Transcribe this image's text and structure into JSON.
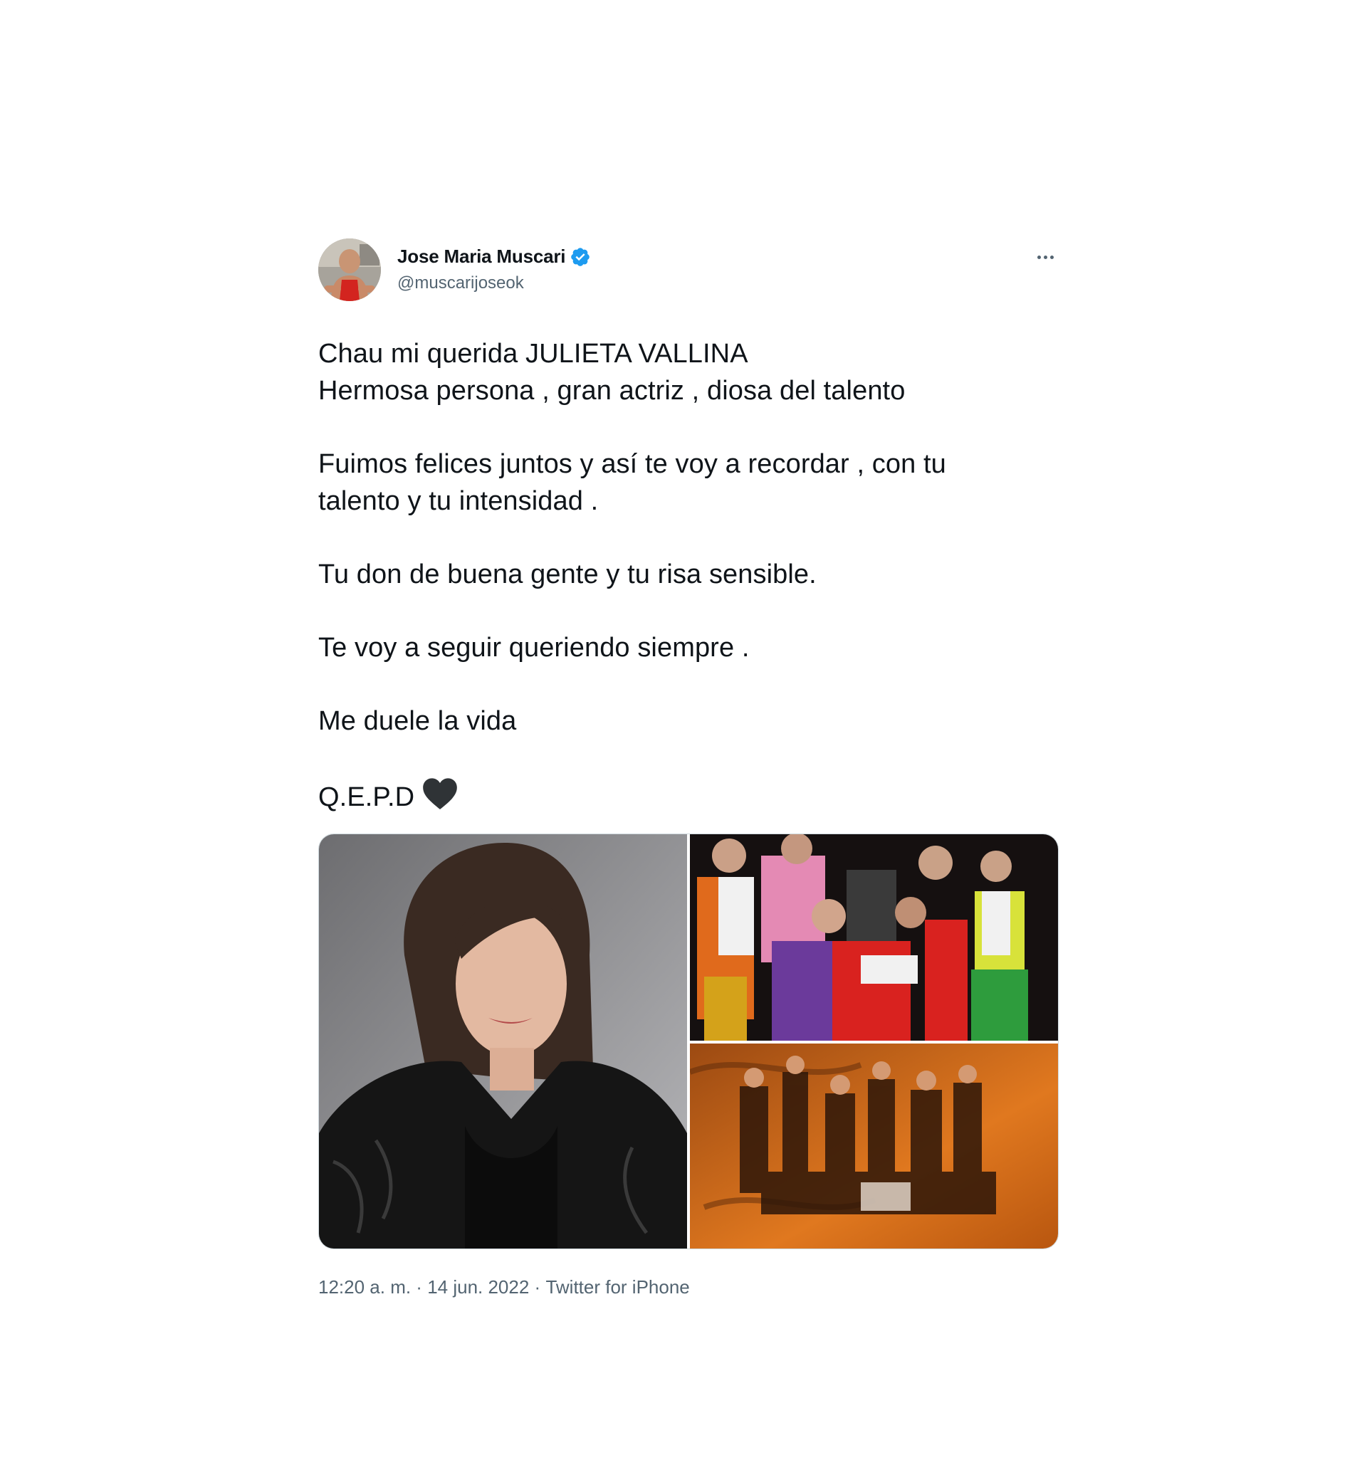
{
  "tweet": {
    "author": {
      "display_name": "Jose Maria Muscari",
      "handle": "@muscarijoseok",
      "verified": true,
      "avatar_icon": "profile-photo"
    },
    "more_icon": "more-options-icon",
    "lines": [
      "Chau mi querida JULIETA VALLINA",
      "Hermosa persona , gran actriz , diosa del talento",
      "",
      "Fuimos felices juntos y así te voy a recordar , con tu",
      "talento y tu intensidad .",
      "",
      "Tu don de buena gente y tu risa sensible.",
      "",
      "Te voy a seguir queriendo siempre .",
      "",
      "Me duele la vida",
      "",
      "Q.E.P.D"
    ],
    "media": [
      {
        "icon": "portrait-photo"
      },
      {
        "icon": "stage-cast-photo"
      },
      {
        "icon": "stage-dance-photo"
      }
    ],
    "meta": {
      "time": "12:20 a. m.",
      "separator": " · ",
      "date": "14 jun. 2022",
      "source": "Twitter for iPhone"
    },
    "colors": {
      "text": "#0f1419",
      "secondary": "#536471",
      "verified": "#1d9bf0",
      "heart": "#2f3336"
    }
  }
}
